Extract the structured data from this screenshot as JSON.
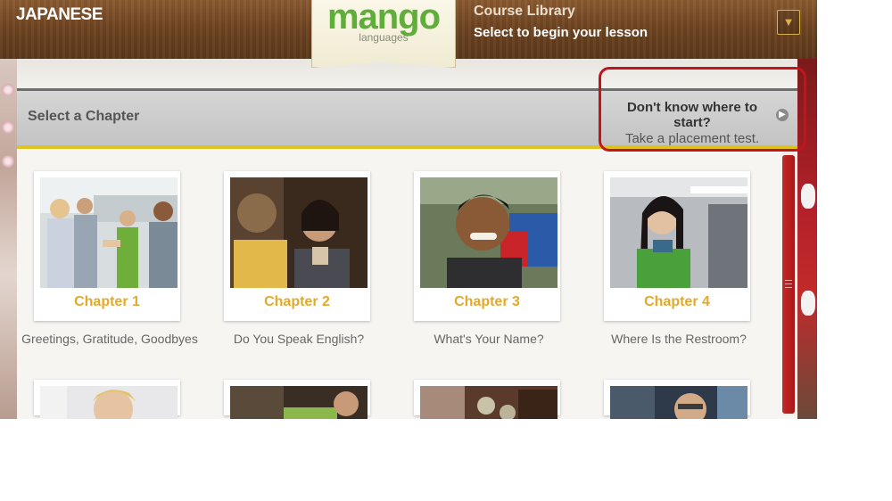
{
  "header": {
    "language_title": "JAPANESE",
    "logo_main": "mango",
    "logo_sub": "languages",
    "course_library": "Course Library",
    "instruction": "Select to begin your lesson",
    "menu_icon": "chevron-down-icon"
  },
  "chapter_bar": {
    "label": "Select a Chapter",
    "placement_question": "Don't know where to start?",
    "placement_text": "Take a placement test.",
    "placement_icon": "chevron-right-icon"
  },
  "chapters": [
    {
      "title": "Chapter 1",
      "subtitle": "Greetings, Gratitude, Goodbyes"
    },
    {
      "title": "Chapter 2",
      "subtitle": "Do You Speak English?"
    },
    {
      "title": "Chapter 3",
      "subtitle": "What's Your Name?"
    },
    {
      "title": "Chapter 4",
      "subtitle": "Where Is the Restroom?"
    }
  ],
  "colors": {
    "brand_green": "#5fae3a",
    "chapter_gold": "#e3a92a",
    "highlight_red": "#c0151d",
    "scroll_red": "#b3202a"
  }
}
